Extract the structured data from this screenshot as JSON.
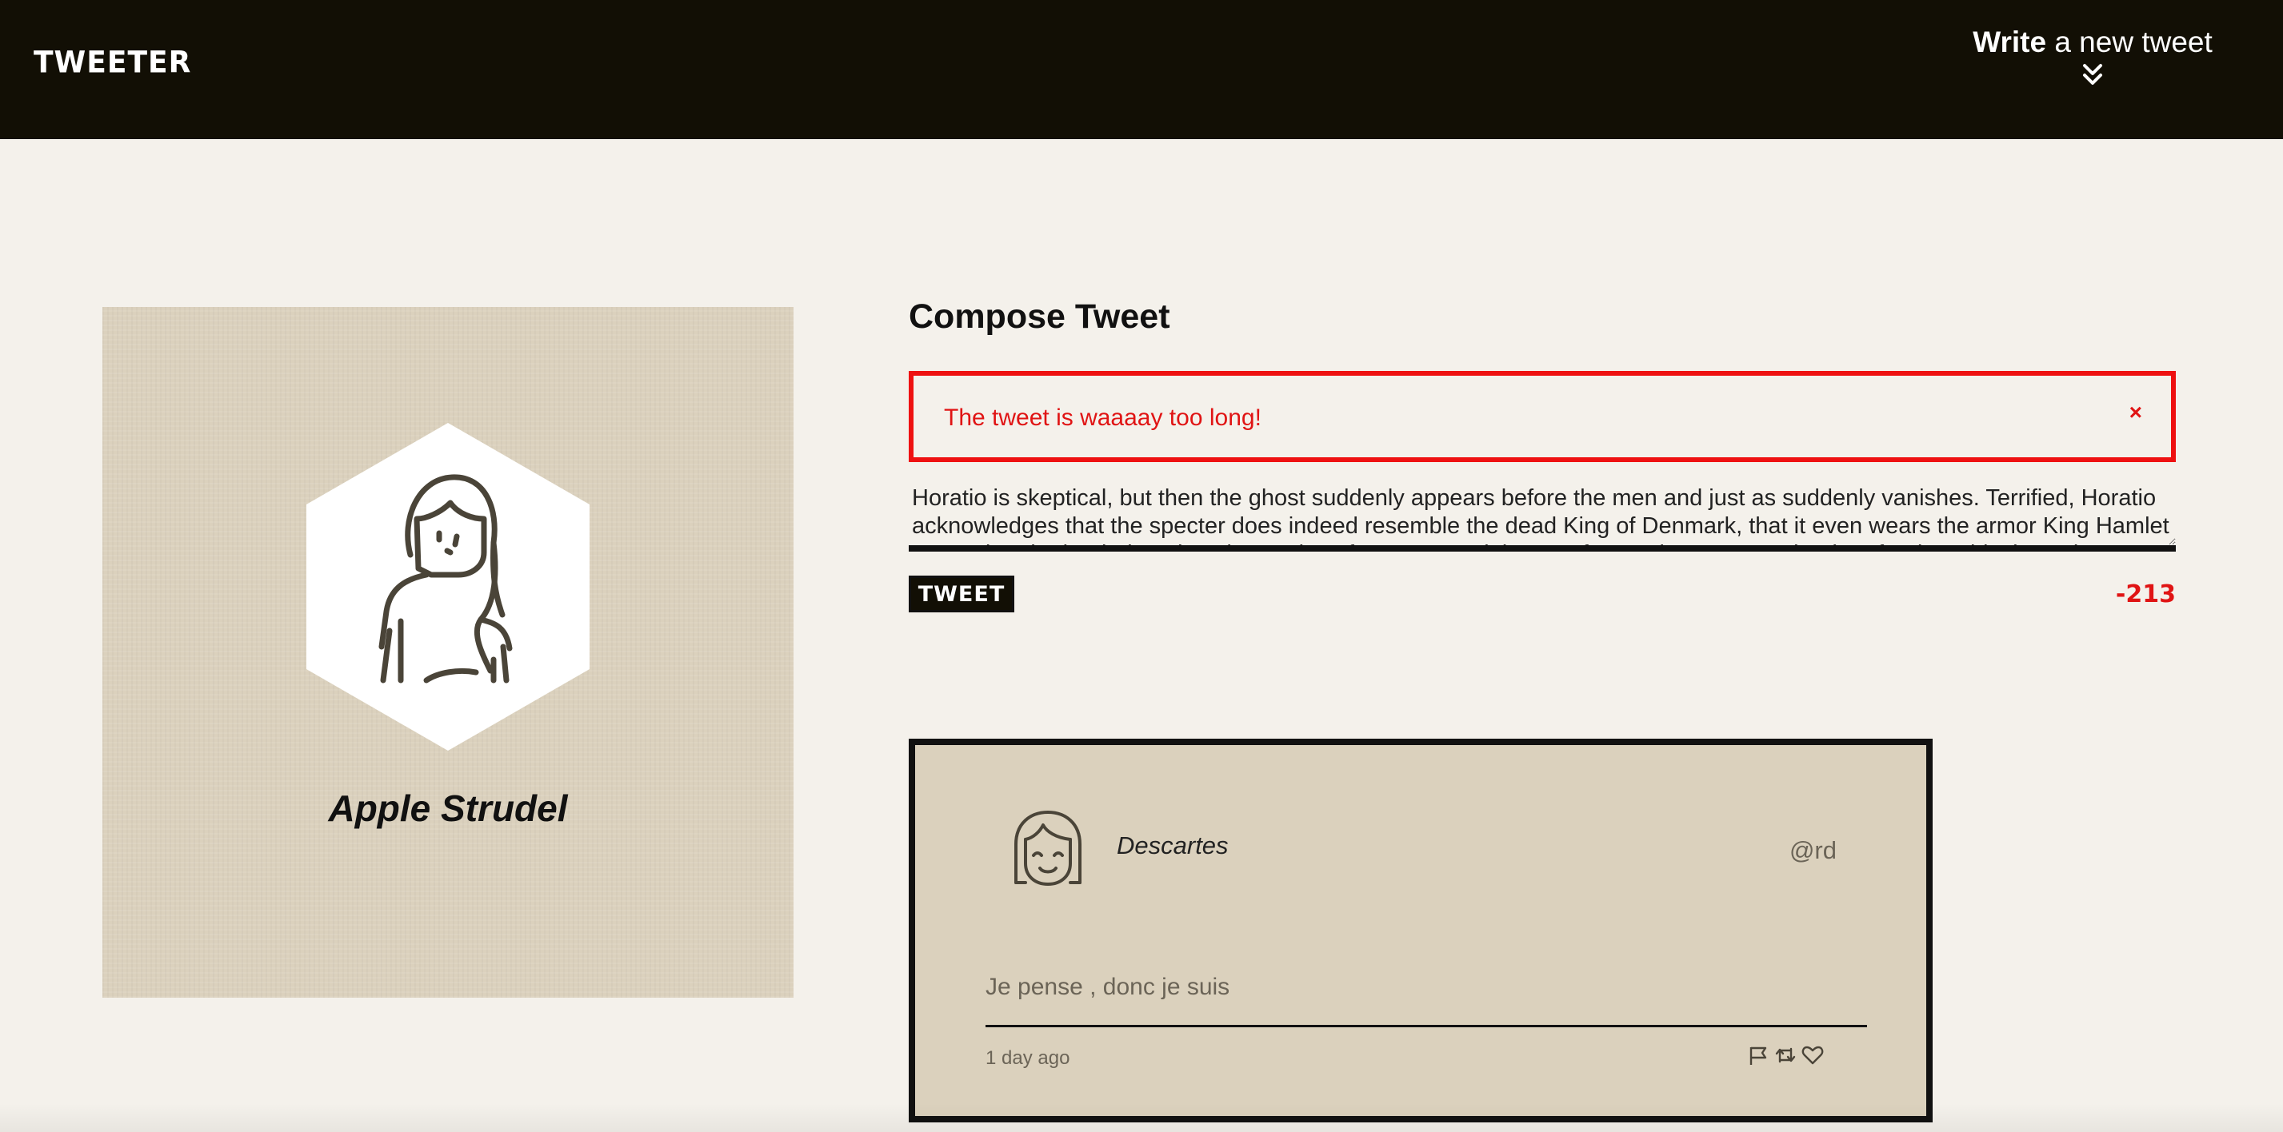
{
  "nav": {
    "brand": "TWEETER",
    "write_bold": "Write",
    "write_rest": " a new tweet",
    "chevron_icon": "double-chevron-down-icon"
  },
  "profile": {
    "name": "Apple Strudel",
    "avatar_icon": "woman-avatar-icon"
  },
  "compose": {
    "title": "Compose Tweet",
    "error_message": "The tweet is waaaay too long!",
    "error_close": "×",
    "textarea_value": "Horatio is skeptical, but then the ghost suddenly appears before the men and just as suddenly vanishes. Terrified, Horatio acknowledges that the specter does indeed resemble the dead King of Denmark, that it even wears the armor King Hamlet wore when he battled against the armies of Norway, and the way frowned at an angry leader after he raids the Poles",
    "button_label": "TWEET",
    "counter": "-213"
  },
  "tweet": {
    "author_name": "Descartes",
    "handle": "@rd",
    "text": "Je pense , donc je suis",
    "time": "1 day ago",
    "avatar_icon": "girl-smiling-avatar-icon",
    "actions": [
      "flag-icon",
      "retweet-icon",
      "heart-icon"
    ]
  },
  "colors": {
    "nav_bg": "#120f05",
    "page_bg": "#f4f1eb",
    "card_bg": "#dbd1bd",
    "error_red": "#e01414",
    "muted_text": "#6b6457"
  }
}
